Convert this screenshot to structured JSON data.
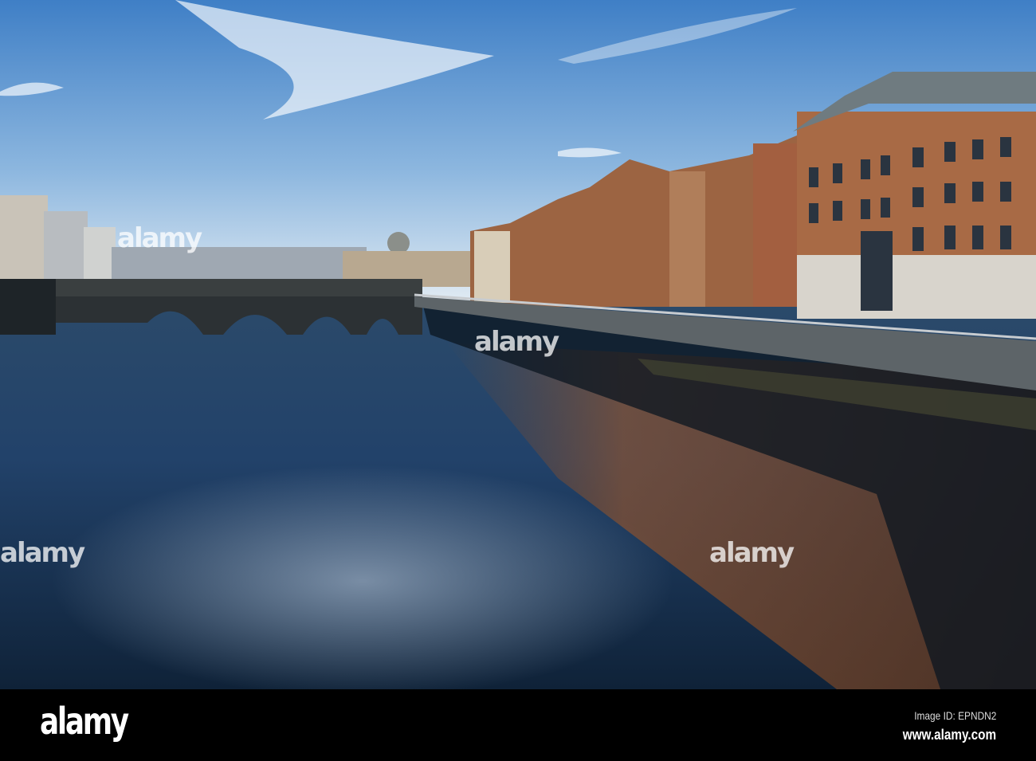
{
  "watermark": "alamy",
  "footer": {
    "logo": "alamy",
    "image_id": "Image ID: EPNDN2",
    "url": "www.alamy.com"
  },
  "colors": {
    "sky_top": "#3f7fc6",
    "sky_horizon": "#e6eef4",
    "water": "#1b3552",
    "brick": "#a0603c",
    "bar": "#000000"
  }
}
